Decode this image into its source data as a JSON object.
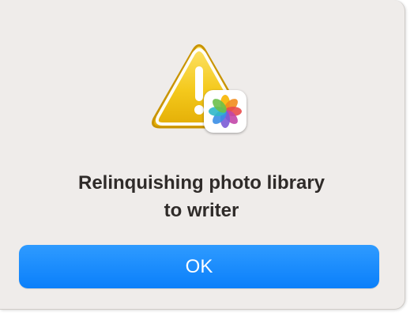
{
  "alert": {
    "icon": "warning-triangle-icon",
    "badge_icon": "photos-app-icon",
    "message_line1": "Relinquishing photo library",
    "message_line2": "to writer",
    "ok_label": "OK"
  },
  "colors": {
    "window_background": "#efecea",
    "button_blue": "#0a7ffa",
    "warning_yellow": "#f1c40f",
    "text": "#2f2b29"
  }
}
